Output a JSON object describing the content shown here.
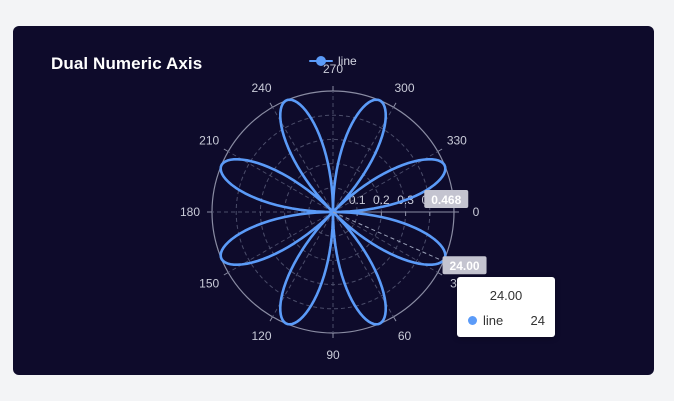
{
  "title": "Dual Numeric Axis",
  "legend": {
    "label": "line",
    "color": "#5b9bf8"
  },
  "tooltip": {
    "title": "24.00",
    "series": "line",
    "value": "24"
  },
  "pointer": {
    "radius_label": "0.468",
    "angle_label": "24.00"
  },
  "chart_data": {
    "type": "line",
    "coordinate": "polar",
    "series": [
      {
        "name": "line",
        "equation": "r = |sin(4 * theta)| / 2",
        "theta_range_deg": [
          0,
          360
        ],
        "theta_step_deg": 1
      }
    ],
    "radius_axis": {
      "ticks": [
        "0",
        "0.1",
        "0.2",
        "0.3",
        "0.4"
      ],
      "range": [
        0,
        0.5
      ]
    },
    "angle_axis": {
      "ticks": [
        "0",
        "30",
        "60",
        "90",
        "120",
        "150",
        "180",
        "210",
        "240",
        "270",
        "300",
        "330"
      ],
      "range": [
        0,
        360
      ],
      "direction": "clockwise"
    },
    "legend_position": "top-center",
    "grid": true
  }
}
